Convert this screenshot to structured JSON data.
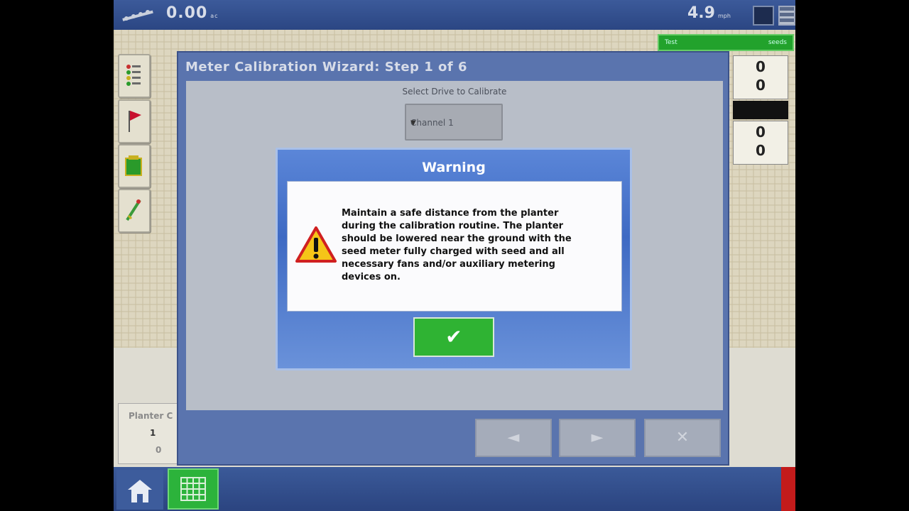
{
  "status_bar": {
    "area_value": "0.00",
    "area_unit": "ac",
    "speed_value": "4.9",
    "speed_unit": "mph"
  },
  "right_panel": {
    "top_values": [
      "0",
      "0"
    ],
    "bottom_values": [
      "0",
      "0"
    ],
    "green_bar_left": "Test",
    "green_bar_right": "seeds"
  },
  "planter_panel": {
    "label": "Planter C",
    "row1": "1",
    "row2": "0"
  },
  "wizard": {
    "title": "Meter Calibration Wizard:  Step 1 of 6",
    "select_label": "Select Drive to Calibrate",
    "select_value": "Channel 1",
    "back_icon": "◄",
    "next_icon": "►",
    "cancel_icon": "✕"
  },
  "warning": {
    "title": "Warning",
    "lines": [
      "Maintain a safe distance from the planter",
      "during the calibration routine. The planter",
      "should be lowered near the ground with the",
      "seed meter fully charged with seed and all",
      "necessary fans and/or auxiliary metering",
      "devices on."
    ],
    "ok_icon": "✔"
  },
  "colors": {
    "bar_blue": "#2b4683",
    "wizard_blue": "#5a74ae",
    "warning_blue": "#3e6ac3",
    "ok_green": "#2fb333"
  }
}
